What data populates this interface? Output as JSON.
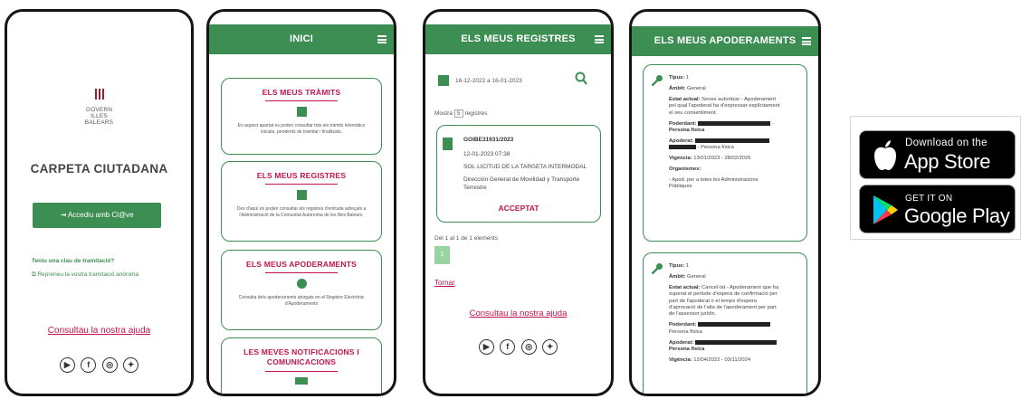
{
  "phone1": {
    "org_lines": [
      "GOVERN",
      "ILLES",
      "BALEARS"
    ],
    "title": "CARPETA CIUTADANA",
    "login_button": "Accediu amb Cl@ve",
    "question": "Teniu una clau de tramitació?",
    "resume_link": "Repreneu la vostra tramitació anònima",
    "help_link": "Consultau la nostra ajuda"
  },
  "phone2": {
    "header": "INICI",
    "cards": [
      {
        "title": "ELS MEUS TRÀMITS",
        "desc": "En aquest apartat es poden consultar tots els tràmits telemàtics iniciats, pendents de tramitar i finalitzats."
      },
      {
        "title": "ELS MEUS REGISTRES",
        "desc": "Des d'aquí es poden consultar els registres d'entrada adreçats a l'Administració de la Comunitat Autònoma de les Illes Balears."
      },
      {
        "title": "ELS MEUS APODERAMENTS",
        "desc": "Consulta dels apoderaments atorgats en el Registre Electrònic d'Apoderaments"
      },
      {
        "title_line1": "LES MEVES NOTIFICACIONS I",
        "title_line2": "COMUNICACIONS"
      }
    ]
  },
  "phone3": {
    "header": "ELS MEUS REGISTRES",
    "date_range": "16-12-2022 a 16-01-2023",
    "show_prefix": "Mostra",
    "show_count": "5",
    "show_suffix": "registres",
    "record": {
      "code": "GOIBE31931/2023",
      "datetime": "12-01-2023 07:38",
      "subject": "SOL·LICITUD DE LA TARGETA INTERMODAL",
      "dest_line1": "Dirección General de Movilidad y Transporte",
      "dest_line2": "Terrestre",
      "status": "ACCEPTAT"
    },
    "pagination_info": "Del 1 al 1 de 1 elements",
    "page": "1",
    "back_link": "Tornar",
    "help_link": "Consultau la nostra ajuda"
  },
  "phone4": {
    "header": "ELS MEUS APODERAMENTS",
    "item1": {
      "tipus_label": "Tipus:",
      "tipus": "1",
      "ambit_label": "Àmbit:",
      "ambit": "General",
      "estat_label": "Estat actual:",
      "estat_l1": "Sense autoritzar - Apoderament",
      "estat_l2": "pel qual l'apoderat ha d'expressar explícitament",
      "estat_l3": "el seu consentiment.",
      "poderdant_label": "Poderdant:",
      "poderdant_suffix": "-",
      "poderdant_type": "Persona física",
      "apoderat_label": "Apoderat:",
      "apoderat_type": "- Persona física",
      "vigencia_label": "Vigència:",
      "vigencia": "13/01/2023 - 28/02/2026",
      "organismes_label": "Organismes:",
      "organismes_l1": "- Apod. per a totes les Administracions",
      "organismes_l2": "Públiques"
    },
    "item2": {
      "tipus_label": "Tipus:",
      "tipus": "1",
      "ambit_label": "Àmbit:",
      "ambit": "General",
      "estat_label": "Estat actual:",
      "estat_l1": "Cancel·lat - Apoderament que ha",
      "estat_l2": "superat el període d'espera de confirmació per",
      "estat_l3": "part de l'apoderat o el temps d'espera",
      "estat_l4": "d'aprovació de l'alta de l'apoderament per part",
      "estat_l5": "de l'assessor jurídic.",
      "poderdant_label": "Poderdant:",
      "poderdant_type": "Persona física",
      "apoderat_label": "Apoderat:",
      "apoderat_type": "Persona física",
      "vigencia_label": "Vigència:",
      "vigencia": "12/04/2022 - 03/11/2024"
    }
  },
  "stores": {
    "apple_small": "Download on the",
    "apple_big": "App Store",
    "google_small": "GET IT ON",
    "google_big": "Google Play"
  },
  "colors": {
    "primary_green": "#3d8e53",
    "accent_crimson": "#c0144d"
  },
  "social_icons": [
    "youtube-icon",
    "facebook-icon",
    "instagram-icon",
    "twitter-icon"
  ]
}
